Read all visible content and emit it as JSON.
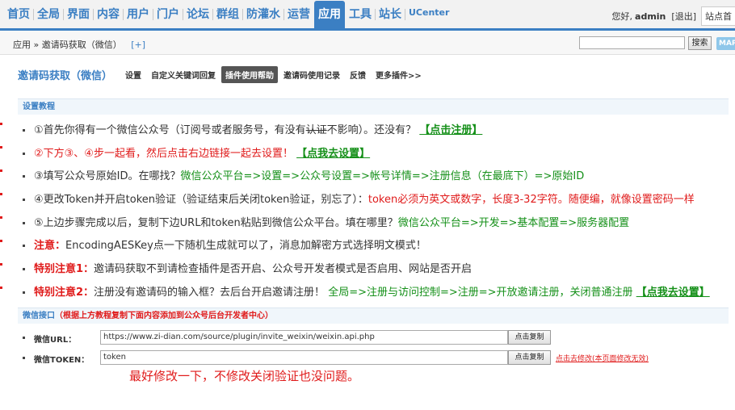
{
  "topnav": {
    "items": [
      "首页",
      "全局",
      "界面",
      "内容",
      "用户",
      "门户",
      "论坛",
      "群组",
      "防灌水",
      "运营",
      "应用",
      "工具",
      "站长",
      "UCenter"
    ],
    "active_index": 10
  },
  "userbox": {
    "greeting": "您好,",
    "username": "admin",
    "logout": "[退出]",
    "site_home": "站点首"
  },
  "breadcrumb": {
    "text": "应用 » 邀请码获取（微信）",
    "plus": "[+]"
  },
  "search": {
    "placeholder": "",
    "button": "搜索",
    "map_button": "MAP"
  },
  "plugin": {
    "title": "邀请码获取（微信）",
    "tabs": [
      "设置",
      "自定义关键词回复",
      "插件使用帮助",
      "邀请码使用记录",
      "反馈",
      "更多插件>>"
    ],
    "active_tab": 2
  },
  "section": {
    "title": "设置教程"
  },
  "steps": {
    "s1_a": "①首先你得有一个微信公众号（订阅号或者服务号，有没有",
    "s1_b": "认证",
    "s1_c": "不影响）。还没有？",
    "s1_link": "【点击注册】",
    "s2_a": "②下方③、④步一起看，然后点击右边链接一起去设置！",
    "s2_link": "【点我去设置】",
    "s3_a": "③填写公众号原始ID。在哪找？",
    "s3_b": "微信公众平台=>设置=>公众号设置=>帐号详情=>注册信息（在最底下）=>原始ID",
    "s4_a": "④更改Token并开启token验证（验证结束后关闭token验证，别忘了）：",
    "s4_b": "token必须为英文或数字，长度3-32字符。随便编，就像设置密码一样",
    "s5_a": "⑤上边步骤完成以后，复制下边URL和token粘贴到微信公众平台。填在哪里？",
    "s5_b": "微信公众平台=>开发=>基本配置=>服务器配置",
    "n1_label": "注意：",
    "n1_text": "EncodingAESKey点一下随机生成就可以了，消息加解密方式选择明文模式！",
    "n2_label": "特别注意1：",
    "n2_text": "邀请码获取不到请检查插件是否开启、公众号开发者模式是否启用、网站是否开启",
    "n3_label": "特别注意2：",
    "n3_text": "注册没有邀请码的输入框？去后台开启邀请注册！",
    "n3_path": "全局=>注册与访问控制=>注册=>开放邀请注册，关闭普通注册",
    "n3_link": "【点我去设置】"
  },
  "api": {
    "title": "微信接口",
    "subtitle": "（根据上方教程复制下面内容添加到公众号后台开发者中心）",
    "url_label": "微信URL：",
    "url_value": "https://www.zi-dian.com/source/plugin/invite_weixin/weixin.api.php",
    "token_label": "微信TOKEN：",
    "token_value": "token",
    "copy_button": "点击复制",
    "modify_link": "点击去修改(本页面修改无效)"
  },
  "note": "最好修改一下，不修改关闭验证也没问题。",
  "colors": {
    "accent": "#3b7fc3",
    "red": "#e01b1b",
    "green": "#159019"
  }
}
